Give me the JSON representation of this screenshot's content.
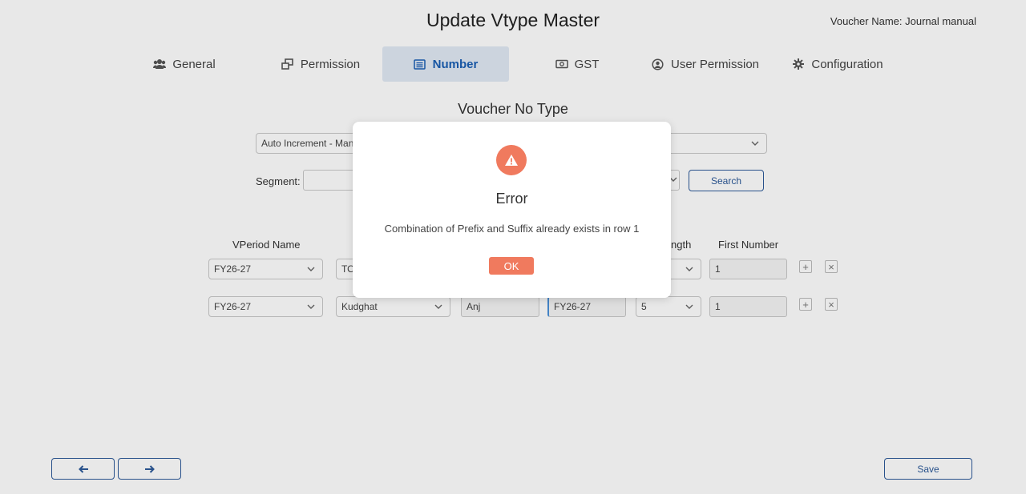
{
  "header": {
    "title": "Update Vtype Master",
    "voucher_name": "Voucher Name: Journal manual"
  },
  "tabs": [
    {
      "label": "General",
      "icon": "users-icon"
    },
    {
      "label": "Permission",
      "icon": "windows-icon"
    },
    {
      "label": "Number",
      "icon": "list-icon",
      "active": true
    },
    {
      "label": "GST",
      "icon": "money-icon"
    },
    {
      "label": "User Permission",
      "icon": "user-circle-icon"
    },
    {
      "label": "Configuration",
      "icon": "gear-icon"
    }
  ],
  "section": {
    "title": "Voucher No Type",
    "voucher_no_type_value": "Auto Increment - Man",
    "segment_label": "Segment:",
    "search_label": "Search"
  },
  "table": {
    "headers": [
      "VPeriod Name",
      "ngth",
      "First Number"
    ],
    "rows": [
      {
        "vperiod": "FY26-27",
        "location": "TO",
        "prefix": "",
        "suffix": "",
        "length": "",
        "first_number": "1"
      },
      {
        "vperiod": "FY26-27",
        "location": "Kudghat",
        "prefix": "Anj",
        "suffix": "FY26-27",
        "length": "5",
        "first_number": "1"
      }
    ]
  },
  "footer": {
    "save_label": "Save"
  },
  "dialog": {
    "title": "Error",
    "message": "Combination of Prefix and Suffix already exists in row 1",
    "ok_label": "OK"
  },
  "colors": {
    "accent": "#2d5a99",
    "error": "#f07a5e",
    "active_tab_bg": "#e1e9f5"
  }
}
